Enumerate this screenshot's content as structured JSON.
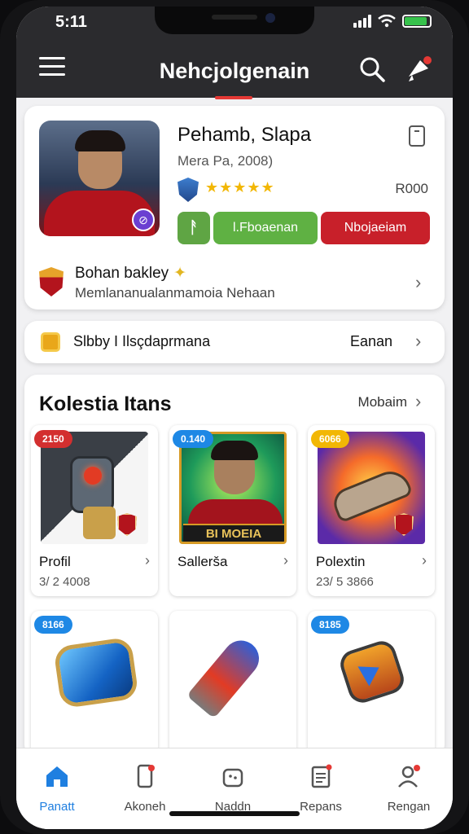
{
  "status_bar": {
    "time": "5:11"
  },
  "app_bar": {
    "title": "Nehcjolgenain"
  },
  "profile": {
    "name": "Pehamb, Slapa",
    "subtitle": "Mera Pa, 2008)",
    "stars": "★★★★★",
    "rank": "R000",
    "action_green_label": "l.Fboaenan",
    "action_red_label": "Nbojaeiam",
    "team_name": "Bohan bakley",
    "team_desc": "Memlananualanmamoia Nehaan"
  },
  "season": {
    "label": "Slbby I Ilsçdaprmana",
    "value": "Eanan"
  },
  "collection": {
    "title": "Kolestia Itans",
    "more_label": "Mobaim",
    "items": [
      {
        "price": "2150",
        "price_color": "#d32f2f",
        "name": "Profil",
        "meta": "3/ 2 4008"
      },
      {
        "price": "0.140",
        "price_color": "#1e88e5",
        "name": "Sallerša",
        "meta": "",
        "banner": "BI MOEIA"
      },
      {
        "price": "6066",
        "price_color": "#f2b705",
        "name": "Polextin",
        "meta": "23/ 5 3866"
      },
      {
        "price": "8166",
        "price_color": "#1e88e5",
        "name": "",
        "meta": ""
      },
      {
        "price": "",
        "price_color": "#1e88e5",
        "name": "",
        "meta": ""
      },
      {
        "price": "8185",
        "price_color": "#1e88e5",
        "name": "",
        "meta": ""
      }
    ]
  },
  "bottom_nav": [
    {
      "label": "Panatt",
      "icon": "home-icon",
      "active": true
    },
    {
      "label": "Akoneh",
      "icon": "phone-icon"
    },
    {
      "label": "Naddn",
      "icon": "bag-icon"
    },
    {
      "label": "Repans",
      "icon": "clipboard-icon"
    },
    {
      "label": "Rengan",
      "icon": "profile-icon"
    }
  ],
  "colors": {
    "accent_red": "#c8202a",
    "accent_green": "#5fb143",
    "active_blue": "#1f7fe0"
  }
}
